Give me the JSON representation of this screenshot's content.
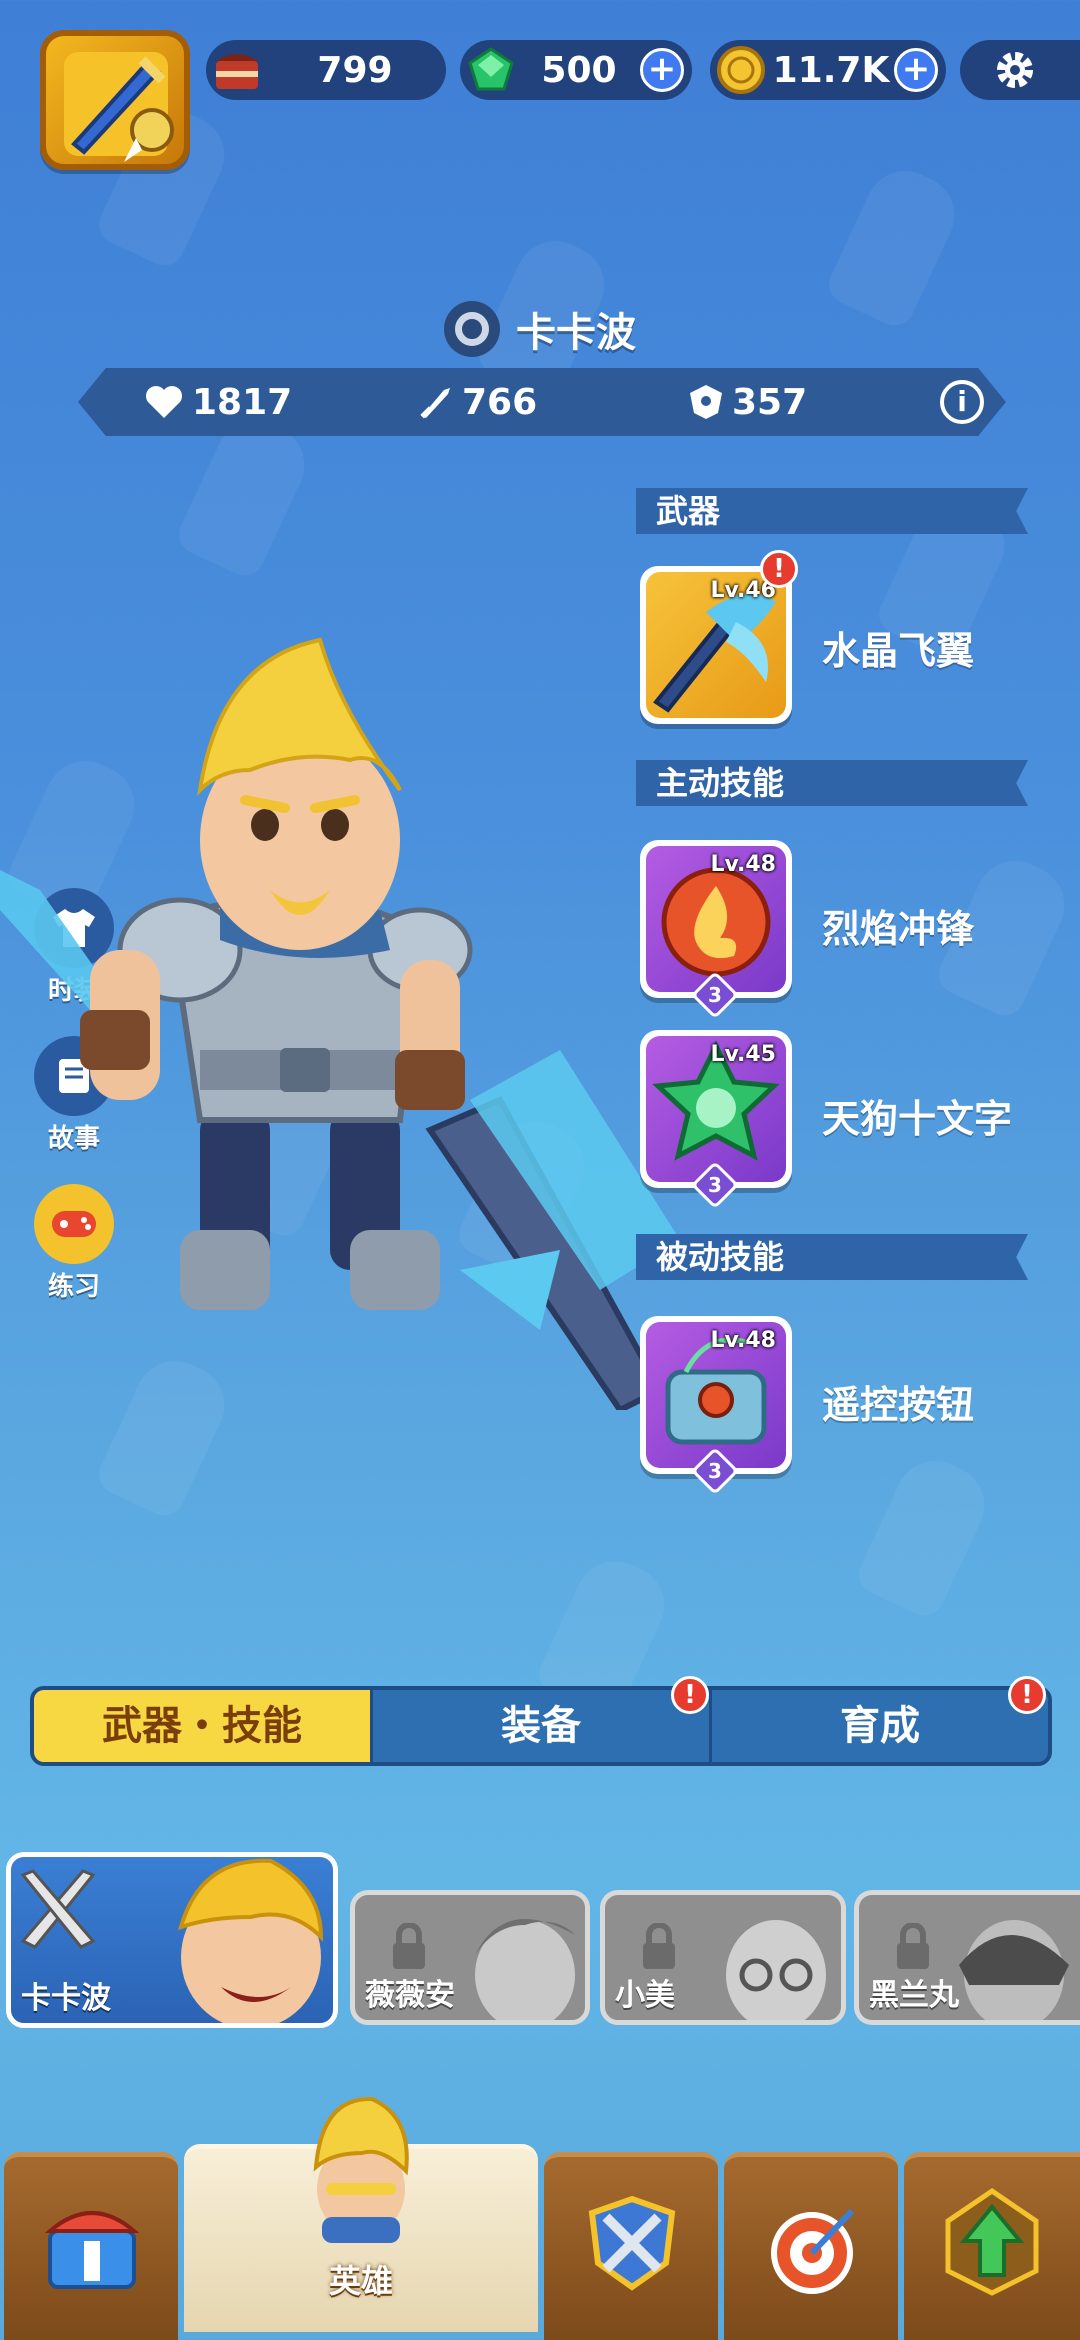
{
  "resources": {
    "cake": {
      "value": "799",
      "icon": "cake-icon"
    },
    "gems": {
      "value": "500",
      "icon": "gem-icon",
      "plus": "+"
    },
    "coins": {
      "value": "11.7K",
      "icon": "coin-icon",
      "plus": "+"
    }
  },
  "hero": {
    "name": "卡卡波",
    "stats": {
      "health": "1817",
      "attack": "766",
      "defense": "357"
    },
    "info_symbol": "i"
  },
  "sections": {
    "weapon": {
      "label": "武器",
      "items": [
        {
          "name": "水晶飞翼",
          "level": "Lv.46",
          "alert": "!"
        }
      ]
    },
    "active": {
      "label": "主动技能",
      "items": [
        {
          "name": "烈焰冲锋",
          "level": "Lv.48",
          "rank": "3"
        },
        {
          "name": "天狗十文字",
          "level": "Lv.45",
          "rank": "3"
        }
      ]
    },
    "passive": {
      "label": "被动技能",
      "items": [
        {
          "name": "遥控按钮",
          "level": "Lv.48",
          "rank": "3"
        }
      ]
    }
  },
  "side_buttons": [
    {
      "label": "时装"
    },
    {
      "label": "故事"
    },
    {
      "label": "练习"
    }
  ],
  "tabs": [
    {
      "label": "武器・技能",
      "active": true
    },
    {
      "label": "装备",
      "alert": "!"
    },
    {
      "label": "育成",
      "alert": "!"
    }
  ],
  "roster": [
    {
      "name": "卡卡波",
      "locked": false
    },
    {
      "name": "薇薇安",
      "locked": true
    },
    {
      "name": "小美",
      "locked": true
    },
    {
      "name": "黑兰丸",
      "locked": true
    }
  ],
  "nav": {
    "hero_label": "英雄"
  },
  "colors": {
    "alert": "#e63b2e",
    "tab_active": "#f7d842",
    "accent": "#3f7af0"
  }
}
